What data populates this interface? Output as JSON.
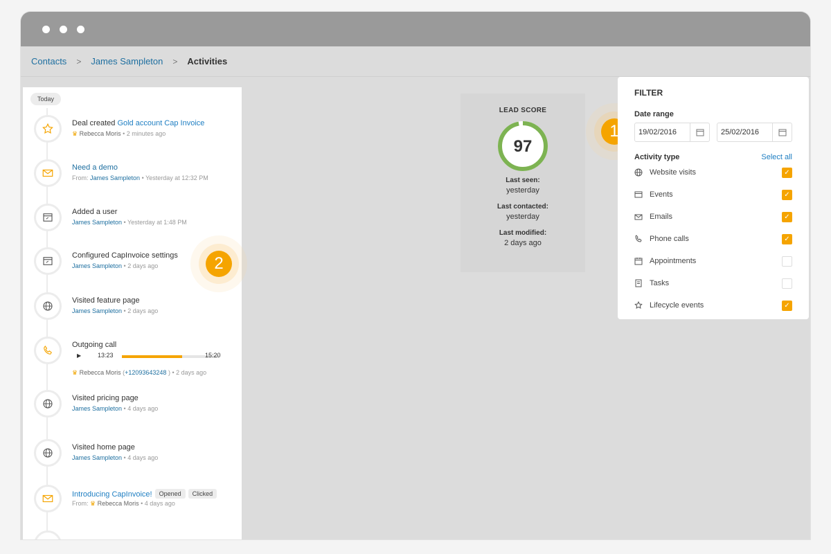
{
  "breadcrumb": {
    "contacts": "Contacts",
    "contact": "James Sampleton",
    "current": "Activities"
  },
  "timeline": {
    "today": "Today",
    "items": [
      {
        "icon": "star-icon",
        "title_prefix": "Deal created ",
        "title_link": "Gold account Cap Invoice",
        "by": "Rebecca Moris",
        "time": "2 minutes ago"
      },
      {
        "icon": "mail-icon",
        "title": "Need a demo",
        "from_label": "From:",
        "by": "James Sampleton",
        "time": "Yesterday at 12:32 PM"
      },
      {
        "icon": "window-icon",
        "title": "Added a user",
        "by": "James Sampleton",
        "time": "Yesterday at 1:48 PM"
      },
      {
        "icon": "window-icon",
        "title": "Configured CapInvoice settings",
        "by": "James Sampleton",
        "time": "2 days ago"
      },
      {
        "icon": "globe-icon",
        "title": "Visited feature page",
        "by": "James Sampleton",
        "time": "2 days ago"
      },
      {
        "icon": "phone-icon",
        "title": "Outgoing call",
        "elapsed": "13:23",
        "duration": "15:20",
        "progress": 0.62,
        "by": "Rebecca Moris",
        "phone": "+12093643248",
        "time": "2 days ago"
      },
      {
        "icon": "globe-icon",
        "title": "Visited pricing page",
        "by": "James Sampleton",
        "time": "4 days ago"
      },
      {
        "icon": "globe-icon",
        "title": "Visited home  page",
        "by": "James Sampleton",
        "time": "4 days ago"
      },
      {
        "icon": "mail-icon",
        "title": "Introducing CapInvoice!",
        "tag1": "Opened",
        "tag2": "Clicked",
        "from_label": "From:",
        "by": "Rebecca Moris",
        "time": "4 days ago"
      }
    ]
  },
  "badges": {
    "one": "1",
    "two": "2"
  },
  "lead": {
    "title": "LEAD SCORE",
    "score": "97",
    "score_value": 97,
    "last_seen_label": "Last seen:",
    "last_seen": "yesterday",
    "last_contacted_label": "Last contacted:",
    "last_contacted": "yesterday",
    "last_modified_label": "Last modified:",
    "last_modified": "2 days ago"
  },
  "filter": {
    "title": "FILTER",
    "date_range_label": "Date range",
    "date_from": "19/02/2016",
    "date_to": "25/02/2016",
    "activity_type_label": "Activity type",
    "select_all": "Select all",
    "options": [
      {
        "icon": "globe-icon",
        "label": "Website visits",
        "checked": true
      },
      {
        "icon": "events-icon",
        "label": "Events",
        "checked": true
      },
      {
        "icon": "mail-icon",
        "label": "Emails",
        "checked": true
      },
      {
        "icon": "phone-icon",
        "label": "Phone calls",
        "checked": true
      },
      {
        "icon": "calendar-icon",
        "label": "Appointments",
        "checked": false
      },
      {
        "icon": "tasks-icon",
        "label": "Tasks",
        "checked": false
      },
      {
        "icon": "star-icon",
        "label": "Lifecycle events",
        "checked": true
      }
    ]
  },
  "colors": {
    "accent": "#f5a400",
    "link": "#1e6fa0",
    "score_ring": "#7db352"
  }
}
